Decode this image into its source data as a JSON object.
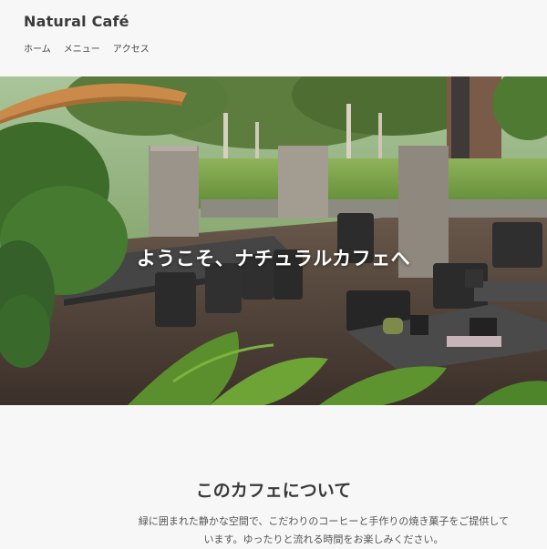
{
  "site": {
    "title": "Natural Café"
  },
  "nav": {
    "items": [
      "ホーム",
      "メニュー",
      "アクセス"
    ]
  },
  "hero": {
    "heading": "ようこそ、ナチュラルカフェへ"
  },
  "about": {
    "title": "このカフェについて",
    "body": "緑に囲まれた静かな空間で、こだわりのコーヒーと手作りの焼き菓子をご提供しています。ゆったりと流れる時間をお楽しみください。"
  },
  "colors": {
    "page_bg": "#f7f7f7",
    "text": "#333333",
    "hero_text": "#ffffff"
  }
}
